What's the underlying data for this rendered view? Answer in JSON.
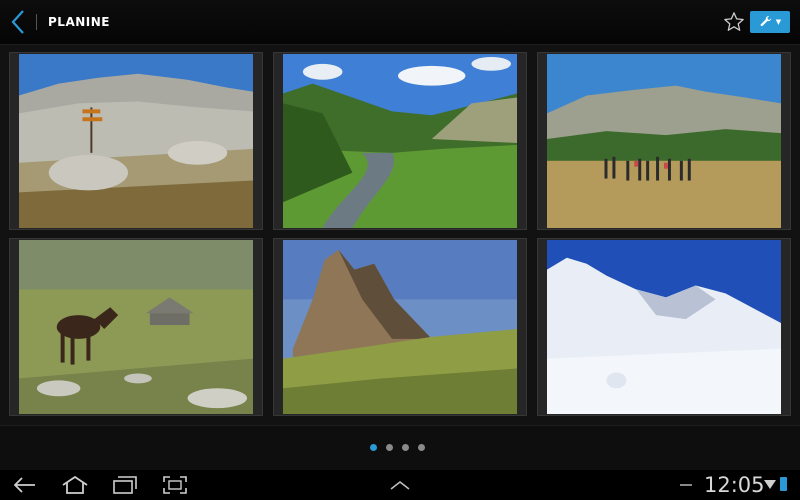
{
  "app": {
    "title": "PLANINE"
  },
  "accent_color": "#2a9ad7",
  "icons": {
    "back": "chevron-left-icon",
    "favorite": "star-outline-icon",
    "tools": "wrench-icon"
  },
  "gallery": {
    "photos": [
      {
        "subject": "rocky-plateau-signpost"
      },
      {
        "subject": "green-valley-stream"
      },
      {
        "subject": "hiking-group-meadow"
      },
      {
        "subject": "horse-and-hut"
      },
      {
        "subject": "rocky-peak"
      },
      {
        "subject": "snowy-mountain"
      }
    ]
  },
  "pager": {
    "pages": 4,
    "current": 1
  },
  "system_bar": {
    "time": "12:05"
  }
}
